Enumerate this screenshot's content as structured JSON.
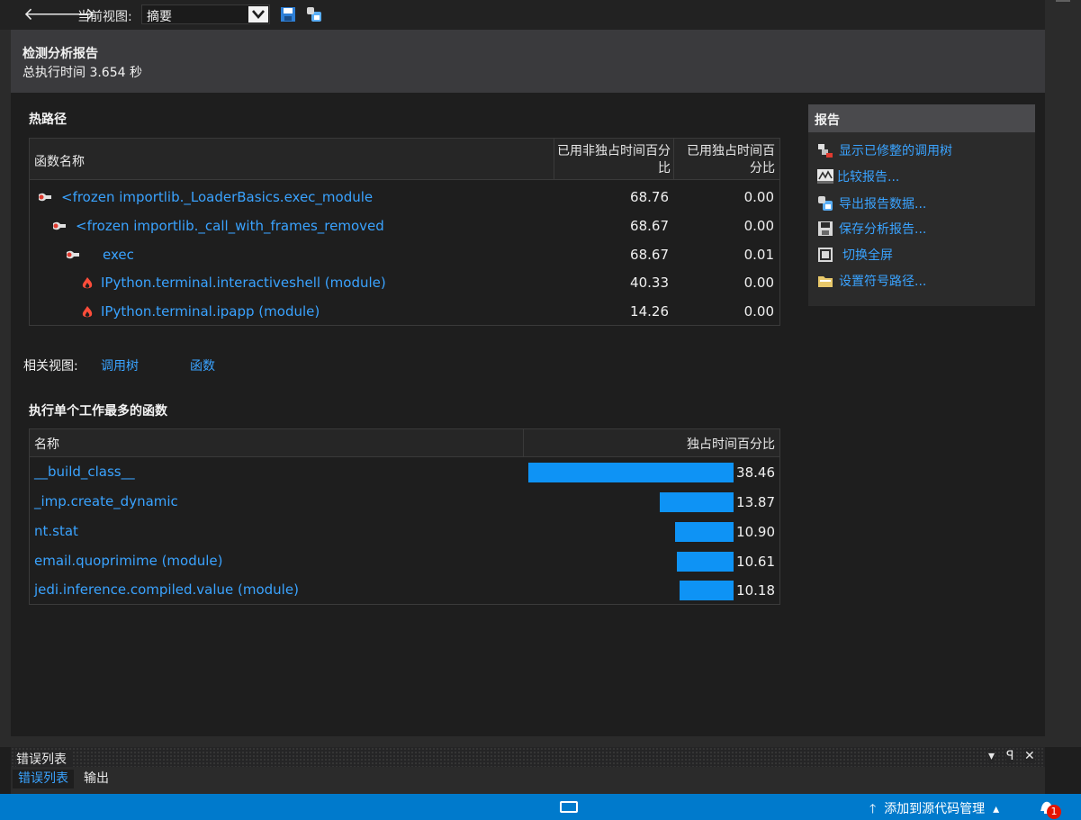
{
  "toolbar": {
    "back_icon": "arrow-left-icon",
    "forward_icon": "arrow-right-icon",
    "current_view_label": "当前视图:",
    "current_view_value": "摘要",
    "save_icon": "save-icon",
    "export_icon": "export-icon"
  },
  "header": {
    "title": "检测分析报告",
    "total_time": "总执行时间 3.654 秒"
  },
  "hot_path": {
    "title": "热路径",
    "columns": {
      "name": "函数名称",
      "inclusive": "已用非独占时间百分比",
      "exclusive": "已用独占时间百分比"
    },
    "rows": [
      {
        "name": "<frozen importlib._LoaderBasics.exec_module",
        "inclusive": "68.76",
        "exclusive": "0.00",
        "icon": "hot-path-icon",
        "level": 0
      },
      {
        "name": "<frozen importlib._call_with_frames_removed",
        "inclusive": "68.67",
        "exclusive": "0.00",
        "icon": "hot-path-icon",
        "level": 1
      },
      {
        "name": "exec",
        "inclusive": "68.67",
        "exclusive": "0.01",
        "icon": "hot-path-icon",
        "level": 2
      },
      {
        "name": "IPython.terminal.interactiveshell (module)",
        "inclusive": "40.33",
        "exclusive": "0.00",
        "icon": "flame-icon",
        "level": 3
      },
      {
        "name": "IPython.terminal.ipapp (module)",
        "inclusive": "14.26",
        "exclusive": "0.00",
        "icon": "flame-icon",
        "level": 3
      }
    ]
  },
  "related_views": {
    "label": "相关视图:",
    "links": [
      "调用树",
      "函数"
    ]
  },
  "top_functions": {
    "title": "执行单个工作最多的函数",
    "columns": {
      "name": "名称",
      "exclusive": "独占时间百分比"
    },
    "bar_color": "#0e93f5",
    "rows": [
      {
        "name": "__build_class__",
        "value": 38.46,
        "label": "38.46"
      },
      {
        "name": "_imp.create_dynamic",
        "value": 13.87,
        "label": "13.87"
      },
      {
        "name": "nt.stat",
        "value": 10.9,
        "label": "10.90"
      },
      {
        "name": "email.quoprimime (module)",
        "value": 10.61,
        "label": "10.61"
      },
      {
        "name": "jedi.inference.compiled.value (module)",
        "value": 10.18,
        "label": "10.18"
      }
    ]
  },
  "report_panel": {
    "title": "报告",
    "items": [
      {
        "label": "显示已修整的调用树",
        "icon": "call-tree-icon"
      },
      {
        "label": "比较报告...",
        "icon": "compare-icon"
      },
      {
        "label": "导出报告数据...",
        "icon": "export-data-icon"
      },
      {
        "label": "保存分析报告...",
        "icon": "save-icon"
      },
      {
        "label": "切换全屏",
        "icon": "fullscreen-icon"
      },
      {
        "label": "设置符号路径...",
        "icon": "folder-icon"
      }
    ]
  },
  "bottom_pane": {
    "title": "错误列表",
    "tabs": [
      "错误列表",
      "输出"
    ],
    "controls": [
      "▾",
      "ꟼ",
      "✕"
    ]
  },
  "status_bar": {
    "source_control": "添加到源代码管理",
    "notification_count": "1",
    "accent": "#007acc"
  }
}
